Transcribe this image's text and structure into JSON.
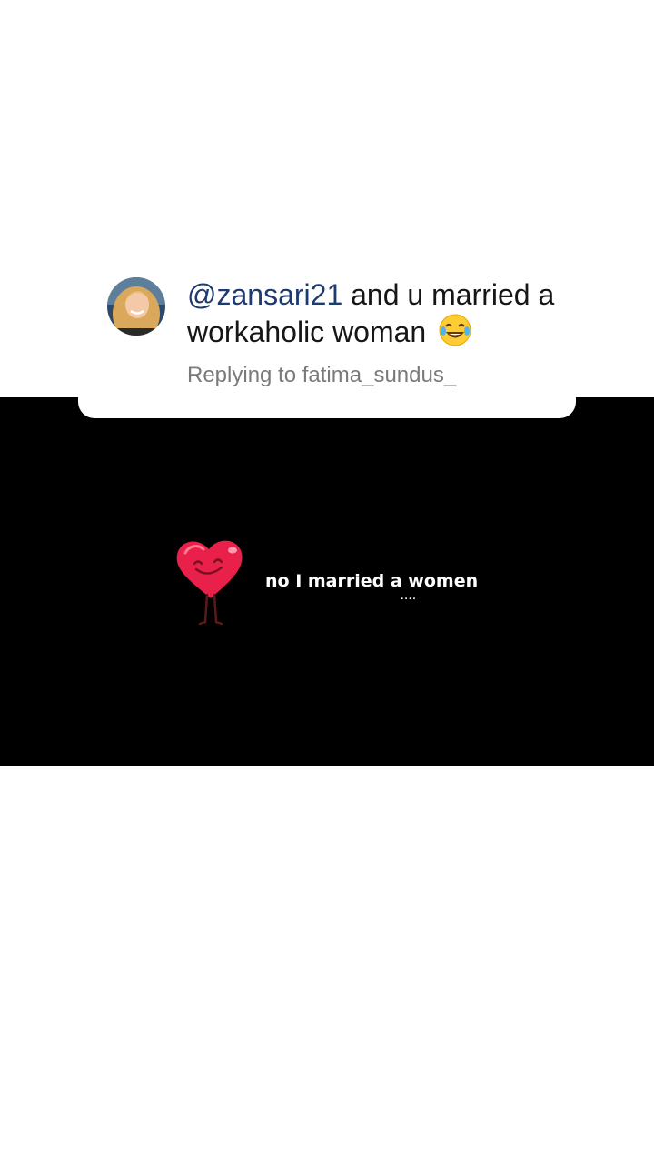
{
  "comment": {
    "mention": "@zansari21",
    "text": " and u married a workaholic woman",
    "emoji": "face-with-tears-of-joy-icon",
    "reply_to": "Replying to fatima_sundus_"
  },
  "video": {
    "sticker": "smiling-heart-icon",
    "caption": "no I married a women",
    "caption_dots": "...."
  },
  "colors": {
    "mention": "#1d3b6e",
    "text": "#161616",
    "reply": "#7a7a7a",
    "video_bg": "#000000",
    "heart": "#e8204a"
  }
}
